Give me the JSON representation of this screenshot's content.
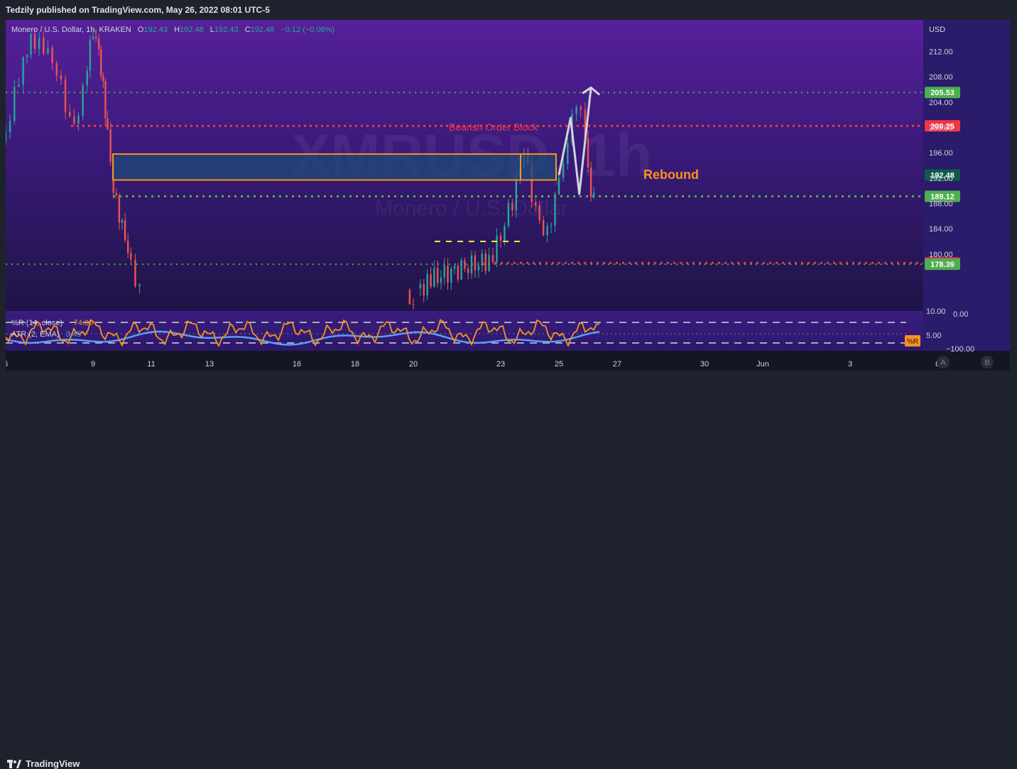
{
  "header": {
    "publish_line": "Tedzily published on TradingView.com, May 26, 2022 08:01 UTC-5",
    "symbol_line": "Monero / U.S. Dollar, 1h, KRAKEN",
    "ohlc": {
      "o_label": "O",
      "o": "192.43",
      "h_label": "H",
      "h": "192.48",
      "l_label": "L",
      "l": "192.43",
      "c_label": "C",
      "c": "192.48",
      "change": "−0.12 (−0.06%)"
    }
  },
  "watermark": {
    "big": "XMRUSD, 1h",
    "small": "Monero / U.S. Dollar"
  },
  "footer": {
    "brand": "TradingView"
  },
  "colors": {
    "up": "#26a69a",
    "down": "#ef5350",
    "orange": "#f7931a",
    "green_label": "#4caf50",
    "red_label": "#f23645",
    "current": "#0f5b4a"
  },
  "chart_data": [
    {
      "type": "line",
      "title": "Monero / U.S. Dollar, 1h, KRAKEN",
      "currency_label": "USD",
      "ylim": [
        171,
        217
      ],
      "y_ticks": [
        212,
        208,
        204,
        200,
        196,
        192,
        188,
        184,
        180
      ],
      "y_tick_labels": [
        "212.00",
        "208.00",
        "204.00",
        "200.00",
        "196.00",
        "192.00",
        "188.00",
        "184.00",
        "180.00"
      ],
      "x_tick_labels": [
        "6",
        "9",
        "11",
        "13",
        "16",
        "18",
        "20",
        "23",
        "25",
        "27",
        "30",
        "Jun",
        "3",
        "6"
      ],
      "price_labels": [
        {
          "value": 205.53,
          "text": "205.53",
          "style": "green"
        },
        {
          "value": 200.25,
          "text": "200.25",
          "style": "red"
        },
        {
          "value": 192.48,
          "text": "192.48",
          "style": "current"
        },
        {
          "value": 189.12,
          "text": "189.12",
          "style": "green"
        },
        {
          "value": 178.6,
          "text": "178.60",
          "style": "red"
        },
        {
          "value": 178.39,
          "text": "178.39",
          "style": "green"
        }
      ],
      "annotations": [
        {
          "text": "Bearish Order Block",
          "color": "#f23645"
        },
        {
          "text": "Rebound",
          "color": "#f7931a"
        }
      ],
      "order_block": {
        "low": 191.7,
        "high": 195.8
      },
      "projection_path": [
        [
          25.0,
          192.5
        ],
        [
          25.4,
          201.5
        ],
        [
          25.7,
          189.5
        ],
        [
          26.1,
          206.3
        ]
      ],
      "close_series": [
        [
          6.0,
          197.8
        ],
        [
          6.3,
          205.2
        ],
        [
          6.6,
          211.5
        ],
        [
          7.0,
          214.0
        ],
        [
          7.3,
          212.6
        ],
        [
          7.6,
          209.4
        ],
        [
          7.9,
          206.0
        ],
        [
          8.2,
          201.2
        ],
        [
          8.5,
          203.0
        ],
        [
          8.8,
          210.5
        ],
        [
          9.0,
          214.5
        ],
        [
          9.2,
          211.0
        ],
        [
          9.35,
          206.0
        ],
        [
          9.5,
          200.0
        ],
        [
          9.7,
          191.2
        ],
        [
          9.9,
          186.0
        ],
        [
          10.1,
          181.5
        ],
        [
          10.3,
          177.5
        ],
        [
          10.6,
          174.5
        ],
        [
          10.9,
          172.0
        ],
        [
          11.3,
          171.5
        ]
      ]
    },
    {
      "type": "line",
      "title": "",
      "ylim": [
        -100,
        0
      ],
      "y_ticks": [
        0,
        -100
      ],
      "y_tick_labels": [
        "0.00",
        "−100.00"
      ],
      "series": [
        {
          "name": "%R (14, close)",
          "value_text": "−74.80",
          "color": "#f7931a"
        },
        {
          "name": "ATR (2, EMA)",
          "value_text": "3.45",
          "color": "#5b9cf6"
        }
      ],
      "extra_labels": [
        {
          "text": "10.00"
        },
        {
          "text": "5.00"
        }
      ],
      "pane_badge": "%R"
    }
  ]
}
